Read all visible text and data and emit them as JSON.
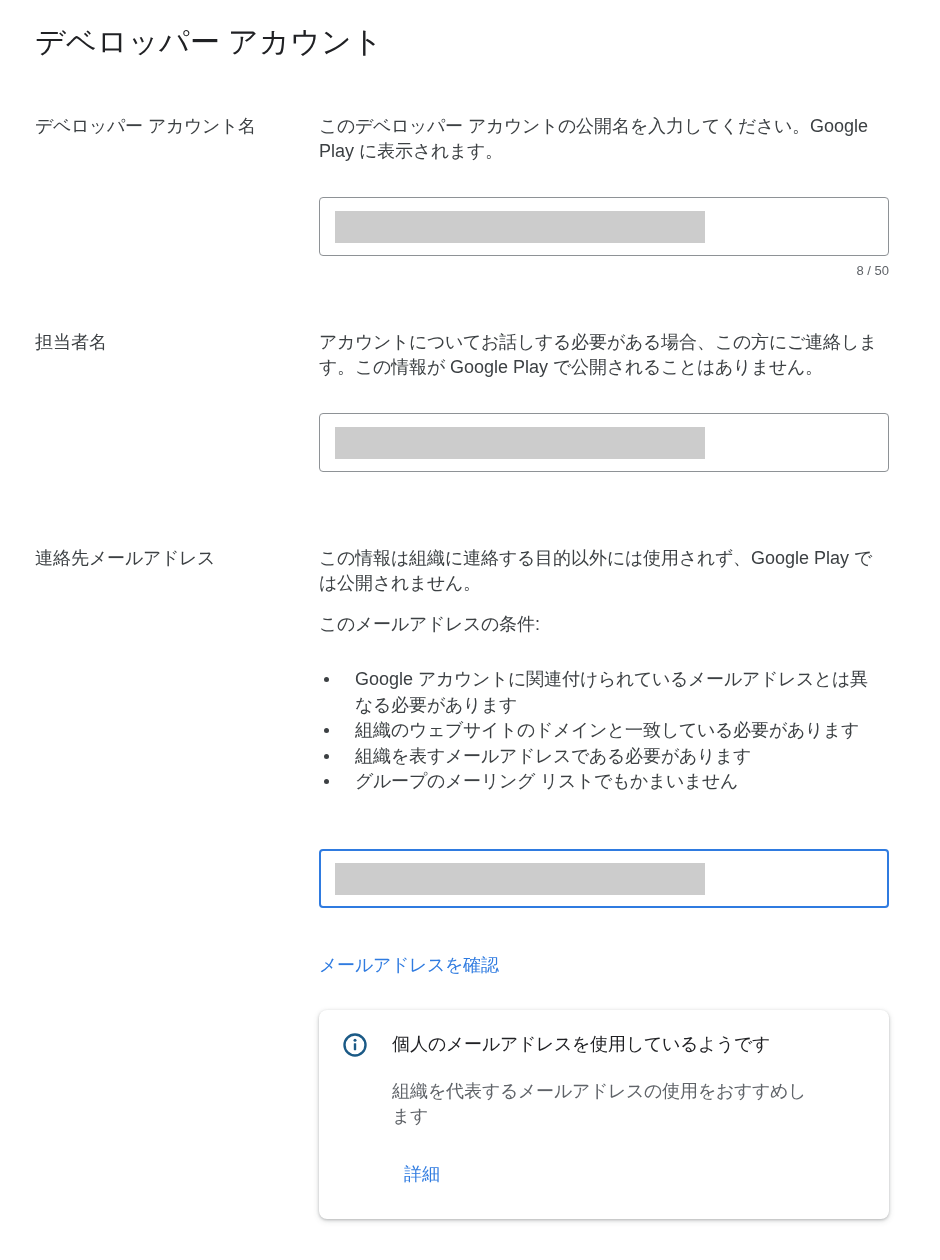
{
  "title": "デベロッパー アカウント",
  "sections": [
    {
      "label": "デベロッパー アカウント名",
      "description": "このデベロッパー アカウントの公開名を入力してください。Google Play に表示されます。",
      "field": {
        "focused": false,
        "counter": "8 / 50"
      }
    },
    {
      "label": "担当者名",
      "description": "アカウントについてお話しする必要がある場合、この方にご連絡します。この情報が Google Play で公開されることはありません。",
      "field": {
        "focused": false
      }
    },
    {
      "label": "連絡先メールアドレス",
      "description": "この情報は組織に連絡する目的以外には使用されず、Google Play では公開されません。",
      "requirements_title": "このメールアドレスの条件:",
      "requirements": [
        "Google アカウントに関連付けられているメールアドレスとは異なる必要があります",
        "組織のウェブサイトのドメインと一致している必要があります",
        "組織を表すメールアドレスである必要があります",
        "グループのメーリング リストでもかまいません"
      ],
      "field": {
        "focused": true
      },
      "link": "メールアドレスを確認",
      "notice": {
        "title": "個人のメールアドレスを使用しているようです",
        "body": "組織を代表するメールアドレスの使用をおすすめします",
        "action": "詳細"
      }
    }
  ]
}
